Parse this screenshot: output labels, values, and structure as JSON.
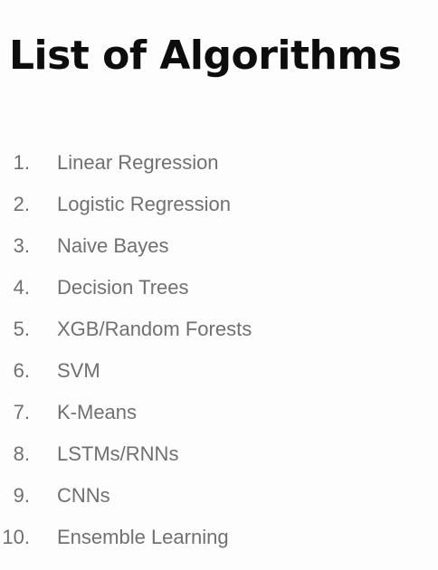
{
  "title": "List of Algorithms",
  "items": [
    {
      "number": "1.",
      "label": "Linear Regression"
    },
    {
      "number": "2.",
      "label": "Logistic Regression"
    },
    {
      "number": "3.",
      "label": "Naive Bayes"
    },
    {
      "number": "4.",
      "label": "Decision Trees"
    },
    {
      "number": "5.",
      "label": "XGB/Random Forests"
    },
    {
      "number": "6.",
      "label": "SVM"
    },
    {
      "number": "7.",
      "label": "K-Means"
    },
    {
      "number": "8.",
      "label": "LSTMs/RNNs"
    },
    {
      "number": "9.",
      "label": "CNNs"
    },
    {
      "number": "10.",
      "label": "Ensemble Learning"
    }
  ],
  "colors": {
    "background": "#fdfdfd",
    "title": "#0d0d0d",
    "list_text": "#707070"
  }
}
